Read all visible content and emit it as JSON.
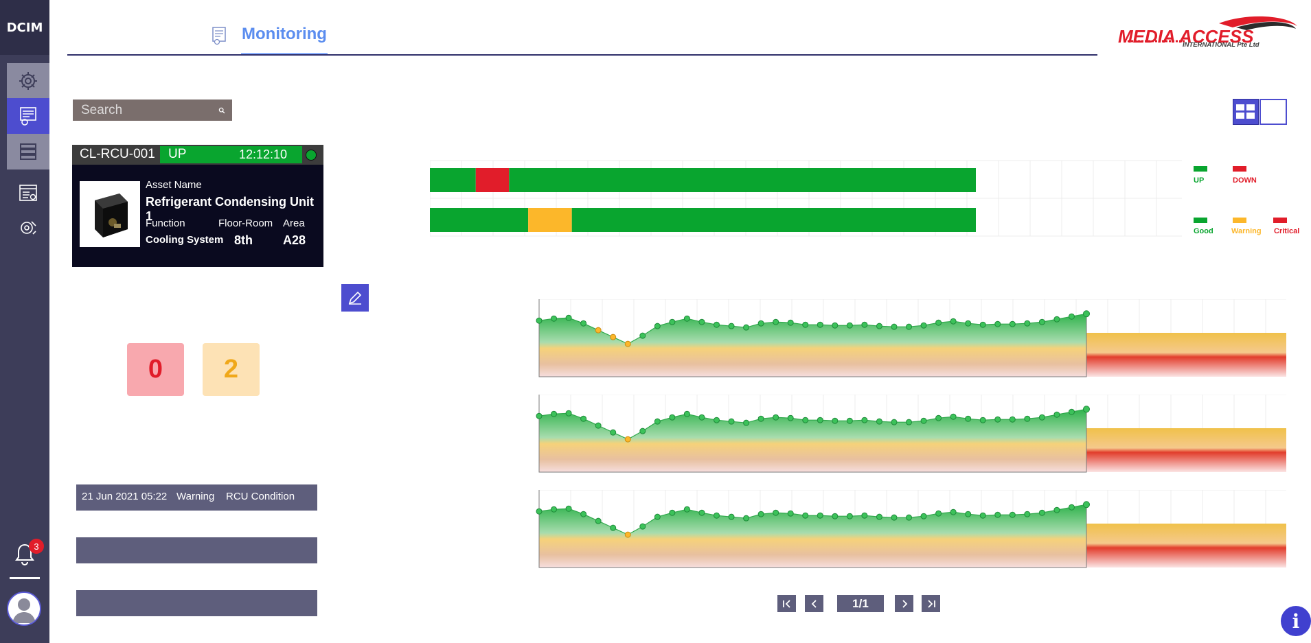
{
  "sidebar": {
    "brand": "DCIM",
    "items": [
      {
        "icon": "gear-dashboard-icon",
        "active": false
      },
      {
        "icon": "monitoring-icon",
        "active": true
      },
      {
        "icon": "server-rack-icon",
        "active": false
      },
      {
        "icon": "browser-settings-icon",
        "active": false
      },
      {
        "icon": "tools-gear-icon",
        "active": false
      }
    ],
    "notifications_count": "3"
  },
  "header": {
    "title": "Monitoring",
    "logo_text": "MEDIA ACCESS",
    "logo_sub": "INTERNATIONAL Pte Ltd"
  },
  "search": {
    "placeholder": "Search"
  },
  "asset_card": {
    "id": "CL-RCU-001",
    "status": "UP",
    "time": "12:12:10",
    "asset_name_label": "Asset Name",
    "asset_name": "Refrigerant Condensing Unit 1",
    "function_label": "Function",
    "function": "Cooling System",
    "floor_room_label": "Floor-Room",
    "floor_room": "8th",
    "area_label": "Area",
    "area": "A28"
  },
  "counts": {
    "critical": "0",
    "warning": "2"
  },
  "events": [
    {
      "date": "21 Jun 2021 05:22",
      "severity": "Warning",
      "description": "RCU Condition"
    },
    {
      "date": "",
      "severity": "",
      "description": ""
    },
    {
      "date": "",
      "severity": "",
      "description": ""
    }
  ],
  "status_timeline": {
    "rows": [
      {
        "segments": [
          {
            "state": "up",
            "span": [
              0,
              0.084
            ]
          },
          {
            "state": "down",
            "span": [
              0.084,
              0.145
            ]
          },
          {
            "state": "up",
            "span": [
              0.145,
              1.0
            ]
          }
        ],
        "fill_fraction": 0.725
      },
      {
        "segments": [
          {
            "state": "good",
            "span": [
              0,
              0.18
            ]
          },
          {
            "state": "warning",
            "span": [
              0.18,
              0.26
            ]
          },
          {
            "state": "good",
            "span": [
              0.26,
              1.0
            ]
          }
        ],
        "fill_fraction": 0.725
      }
    ]
  },
  "legend": {
    "up": "UP",
    "down": "DOWN",
    "good": "Good",
    "warning": "Warning",
    "critical": "Critical"
  },
  "colors": {
    "green": "#09a52f",
    "red": "#e11d2a",
    "orange": "#fcb72a",
    "accent": "#4d4dcf",
    "sidebar": "#3d3d59"
  },
  "chart_data": [
    {
      "type": "area",
      "warn_points": [
        4,
        5,
        6
      ],
      "values": [
        82,
        85,
        86,
        78,
        68,
        58,
        48,
        60,
        74,
        80,
        85,
        80,
        76,
        74,
        72,
        78,
        80,
        79,
        76,
        76,
        75,
        75,
        76,
        74,
        73,
        73,
        75,
        79,
        81,
        78,
        76,
        77,
        77,
        78,
        80,
        84,
        88,
        92
      ]
    },
    {
      "type": "area",
      "warn_points": [
        6
      ],
      "values": [
        82,
        85,
        86,
        78,
        68,
        58,
        48,
        60,
        74,
        80,
        85,
        80,
        76,
        74,
        72,
        78,
        80,
        79,
        76,
        76,
        75,
        75,
        76,
        74,
        73,
        73,
        75,
        79,
        81,
        78,
        76,
        77,
        77,
        78,
        80,
        84,
        88,
        92
      ]
    },
    {
      "type": "area",
      "warn_points": [
        6
      ],
      "values": [
        82,
        85,
        86,
        78,
        68,
        58,
        48,
        60,
        74,
        80,
        85,
        80,
        76,
        74,
        72,
        78,
        80,
        79,
        76,
        76,
        75,
        75,
        76,
        74,
        73,
        73,
        75,
        79,
        81,
        78,
        76,
        77,
        77,
        78,
        80,
        84,
        88,
        92
      ]
    }
  ],
  "pagination": {
    "label": "1/1"
  }
}
